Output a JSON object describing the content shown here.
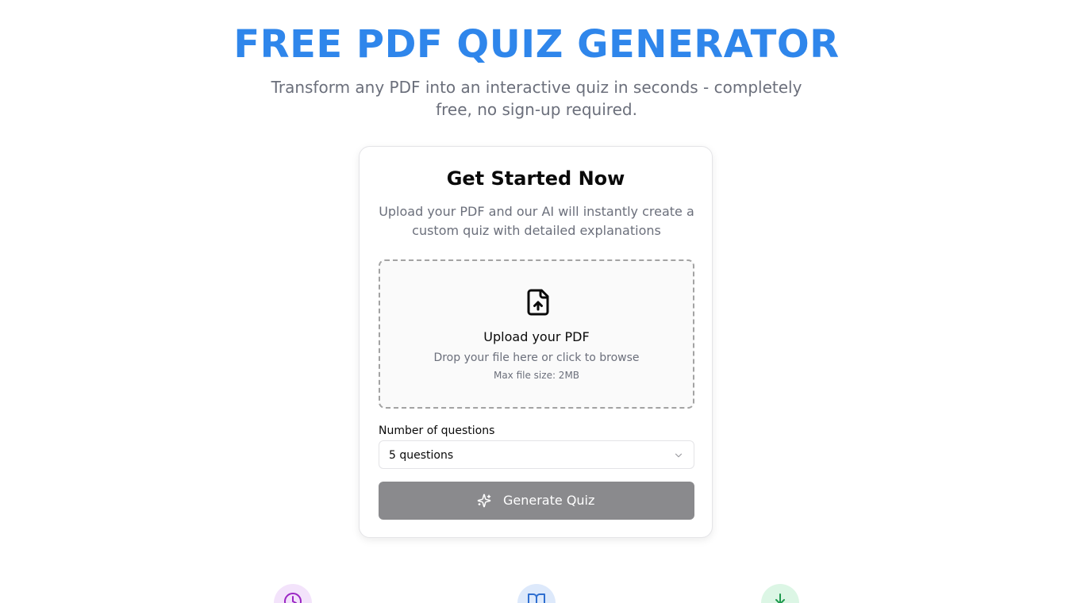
{
  "hero": {
    "title": "FREE PDF QUIZ GENERATOR",
    "subtitle": "Transform any PDF into an interactive quiz in seconds - completely free, no sign-up required."
  },
  "card": {
    "title": "Get Started Now",
    "description": "Upload your PDF and our AI will instantly create a custom quiz with detailed explanations",
    "dropzone": {
      "icon": "file-upload-icon",
      "title": "Upload your PDF",
      "subtitle": "Drop your file here or click to browse",
      "max_size": "Max file size: 2MB"
    },
    "questions": {
      "label": "Number of questions",
      "selected": "5 questions"
    },
    "generate_button": {
      "icon": "sparkles-icon",
      "label": "Generate Quiz"
    }
  },
  "features": [
    {
      "icon": "clock-icon",
      "color": "#9b27c4"
    },
    {
      "icon": "book-open-icon",
      "color": "#2f6fd0"
    },
    {
      "icon": "download-icon",
      "color": "#1f9a4e"
    }
  ],
  "colors": {
    "accent": "#2f86eb",
    "button_disabled": "#8a8a8d",
    "muted_text": "#6b6f7b"
  }
}
